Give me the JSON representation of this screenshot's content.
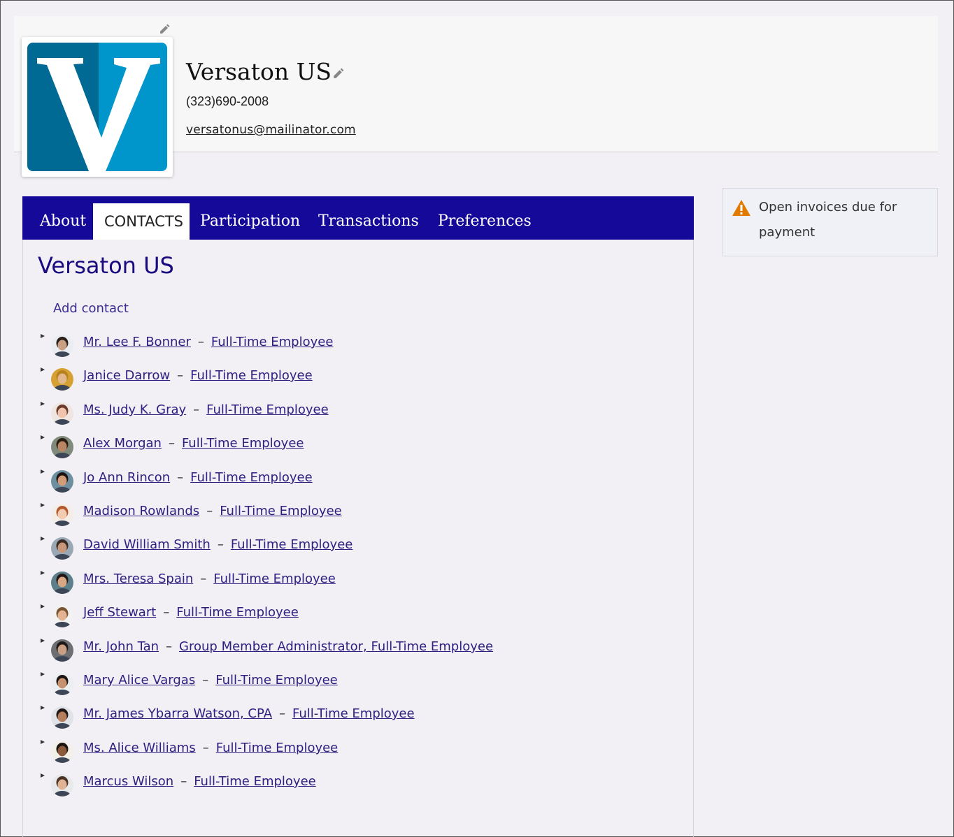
{
  "org": {
    "name": "Versaton US",
    "phone": "(323)690-2008",
    "email": "versatonus@mailinator.com",
    "logo_letter": "V"
  },
  "tabs": [
    {
      "label": "About",
      "active": false
    },
    {
      "label": "CONTACTS",
      "active": true
    },
    {
      "label": "Participation",
      "active": false
    },
    {
      "label": "Transactions",
      "active": false
    },
    {
      "label": "Preferences",
      "active": false
    }
  ],
  "section": {
    "title": "Versaton US",
    "add_contact": "Add contact"
  },
  "contacts": [
    {
      "name": "Mr. Lee F. Bonner",
      "role": "Full-Time Employee",
      "avatar": {
        "skin": "#c9a083",
        "hair": "#2b2018",
        "bg": "#e9edf1"
      }
    },
    {
      "name": "Janice Darrow",
      "role": "Full-Time Employee",
      "avatar": {
        "skin": "#e4b88f",
        "hair": "#b7811e",
        "bg": "#d6a032"
      }
    },
    {
      "name": "Ms. Judy K. Gray",
      "role": "Full-Time Employee",
      "avatar": {
        "skin": "#f0c4ad",
        "hair": "#6b3a2a",
        "bg": "#efe5e1"
      }
    },
    {
      "name": "Alex Morgan",
      "role": "Full-Time Employee",
      "avatar": {
        "skin": "#b98563",
        "hair": "#2a1d14",
        "bg": "#7f8a7a"
      }
    },
    {
      "name": "Jo Ann Rincon",
      "role": "Full-Time Employee",
      "avatar": {
        "skin": "#d29d76",
        "hair": "#1b1411",
        "bg": "#6e8fa0"
      }
    },
    {
      "name": "Madison Rowlands",
      "role": "Full-Time Employee",
      "avatar": {
        "skin": "#f2cbb1",
        "hair": "#b45a2e",
        "bg": "#f4ede8"
      }
    },
    {
      "name": "David William Smith",
      "role": "Full-Time Employee",
      "avatar": {
        "skin": "#c8977a",
        "hair": "#3a2b22",
        "bg": "#9aa7b4"
      }
    },
    {
      "name": "Mrs. Teresa Spain",
      "role": "Full-Time Employee",
      "avatar": {
        "skin": "#d8a784",
        "hair": "#221714",
        "bg": "#5c7f8a"
      }
    },
    {
      "name": "Jeff Stewart",
      "role": "Full-Time Employee",
      "avatar": {
        "skin": "#e3b392",
        "hair": "#7a5533",
        "bg": "#f2f2f2"
      }
    },
    {
      "name": "Mr. John Tan",
      "role": "Group Member Administrator, Full-Time Employee",
      "avatar": {
        "skin": "#c8a083",
        "hair": "#1f1a17",
        "bg": "#6d6f73"
      }
    },
    {
      "name": "Mary Alice Vargas",
      "role": "Full-Time Employee",
      "avatar": {
        "skin": "#c7926f",
        "hair": "#1c1410",
        "bg": "#eceff2"
      }
    },
    {
      "name": "Mr. James Ybarra Watson, CPA",
      "role": "Full-Time Employee",
      "avatar": {
        "skin": "#b57e5d",
        "hair": "#1e1713",
        "bg": "#dfe3e7"
      }
    },
    {
      "name": "Ms. Alice Williams",
      "role": "Full-Time Employee",
      "avatar": {
        "skin": "#8a5a3b",
        "hair": "#1a120e",
        "bg": "#f3efe9"
      }
    },
    {
      "name": "Marcus Wilson",
      "role": "Full-Time Employee",
      "avatar": {
        "skin": "#e0b394",
        "hair": "#4b3424",
        "bg": "#e7e9ea"
      }
    }
  ],
  "alert": {
    "text": "Open invoices due for payment",
    "color": "#e07b00"
  },
  "colors": {
    "tabbar": "#140998",
    "title": "#1a0a80",
    "link": "#2e2080",
    "logo_dark": "#006a94",
    "logo_light": "#0096cc"
  }
}
